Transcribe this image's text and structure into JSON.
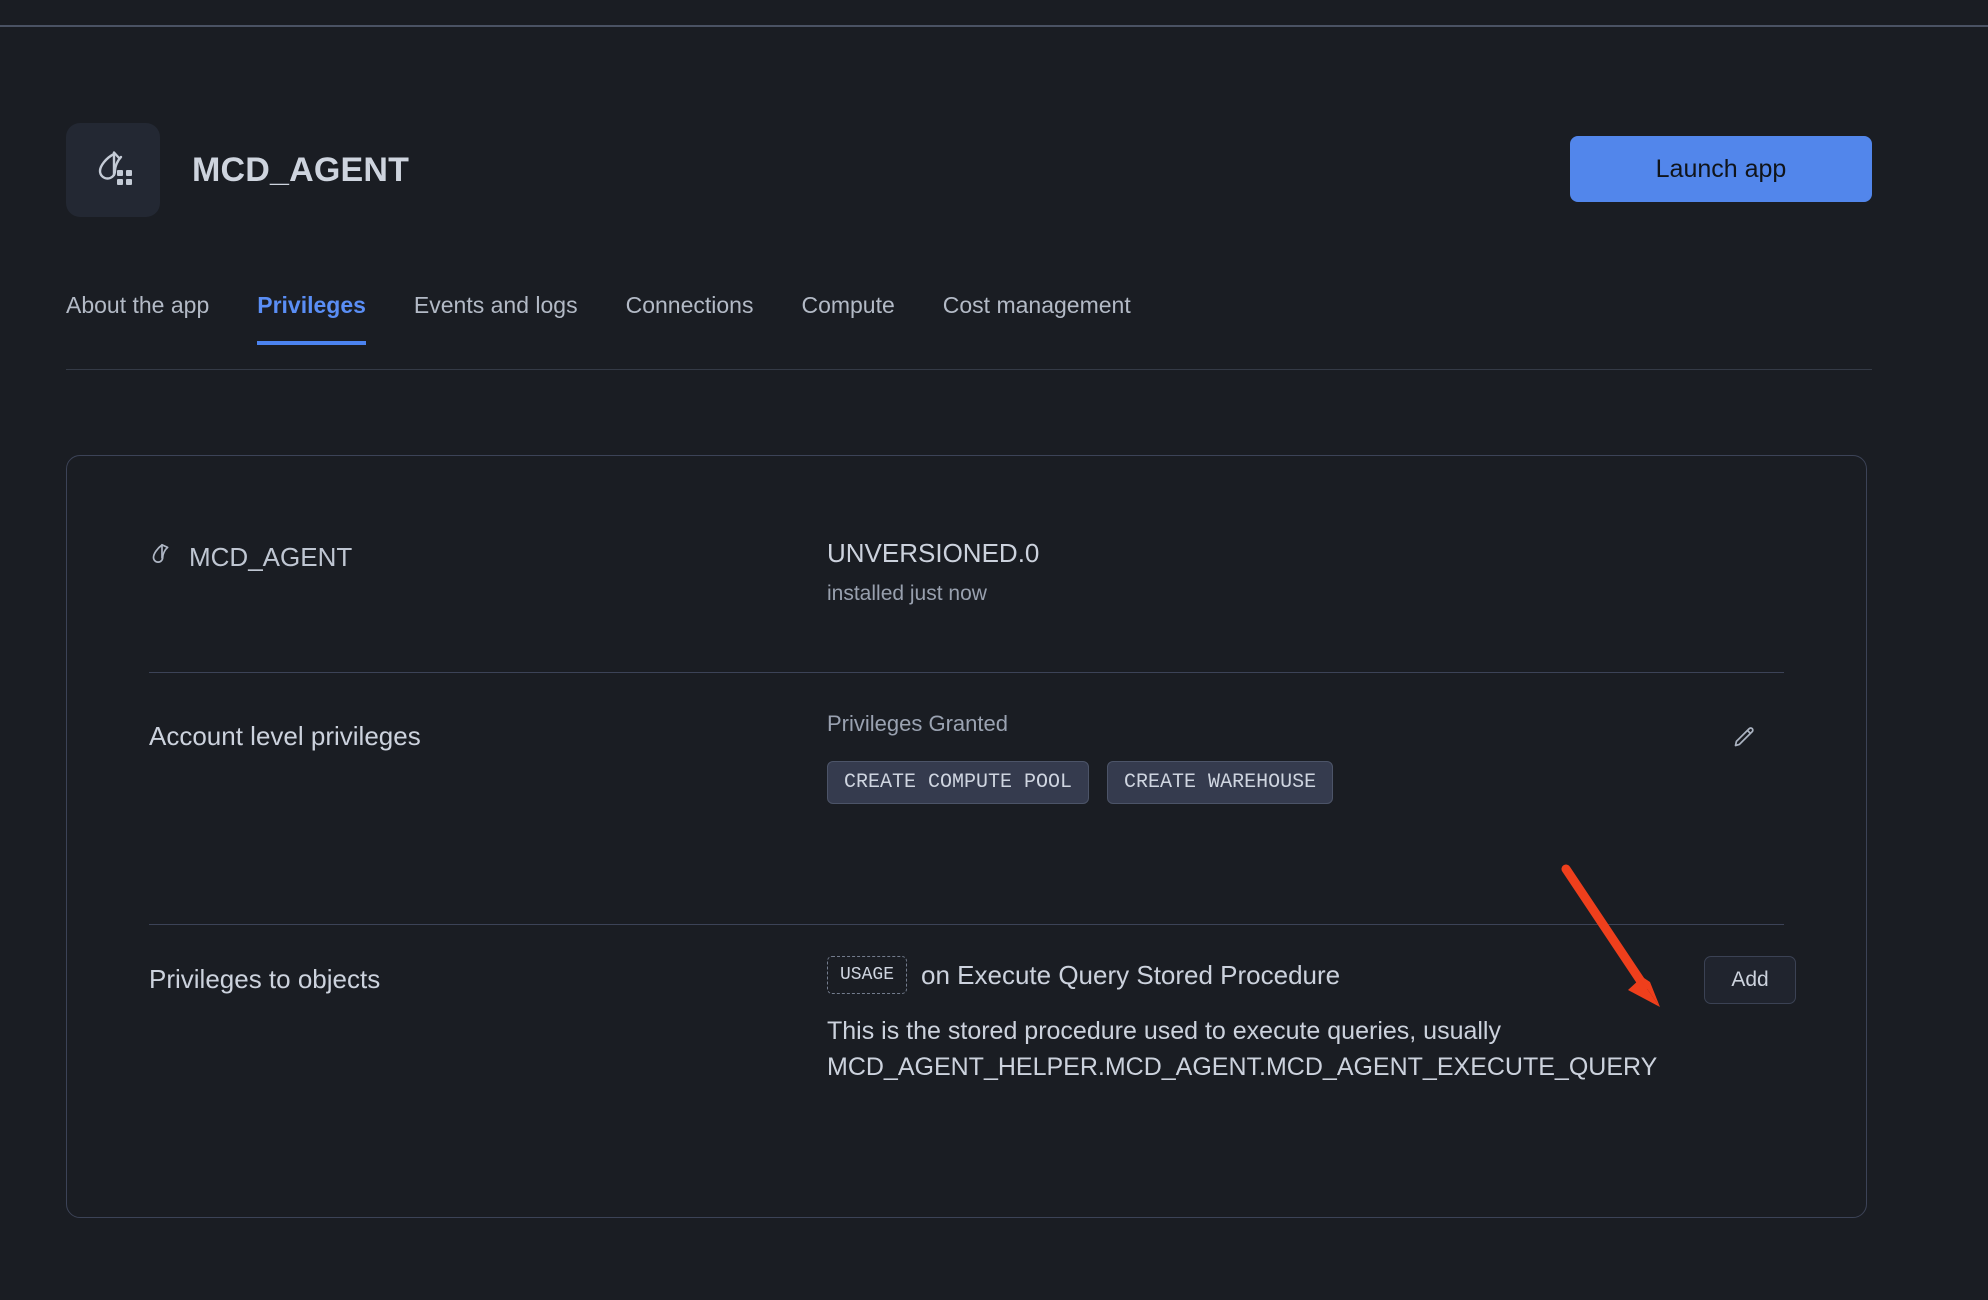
{
  "colors": {
    "page_bg": "#1a1d23",
    "accent_blue": "#5286eb",
    "tab_active": "#5a8ef5",
    "card_border": "#3c4357",
    "annotation_red": "#ef3f1c"
  },
  "header": {
    "logo_icon": "app-loop-grid-icon",
    "title": "MCD_AGENT",
    "launch_label": "Launch app"
  },
  "tabs": [
    {
      "label": "About the app",
      "active": false
    },
    {
      "label": "Privileges",
      "active": true
    },
    {
      "label": "Events and logs",
      "active": false
    },
    {
      "label": "Connections",
      "active": false
    },
    {
      "label": "Compute",
      "active": false
    },
    {
      "label": "Cost management",
      "active": false
    }
  ],
  "card": {
    "app_row": {
      "icon": "app-loop-icon",
      "name": "MCD_AGENT",
      "version": "UNVERSIONED.0",
      "installed": "installed just now"
    },
    "account_privileges": {
      "label": "Account level privileges",
      "granted_label": "Privileges Granted",
      "badges": [
        "CREATE COMPUTE POOL",
        "CREATE WAREHOUSE"
      ],
      "edit_icon": "pencil-edit-icon"
    },
    "object_privileges": {
      "label": "Privileges to objects",
      "privilege_badge": "USAGE",
      "target_text": "on Execute Query Stored Procedure",
      "description": "This is the stored procedure used to execute queries, usually MCD_AGENT_HELPER.MCD_AGENT.MCD_AGENT_EXECUTE_QUERY",
      "add_label": "Add"
    }
  },
  "annotation": {
    "type": "arrow",
    "points_to": "add-button",
    "color": "#ef3f1c"
  }
}
